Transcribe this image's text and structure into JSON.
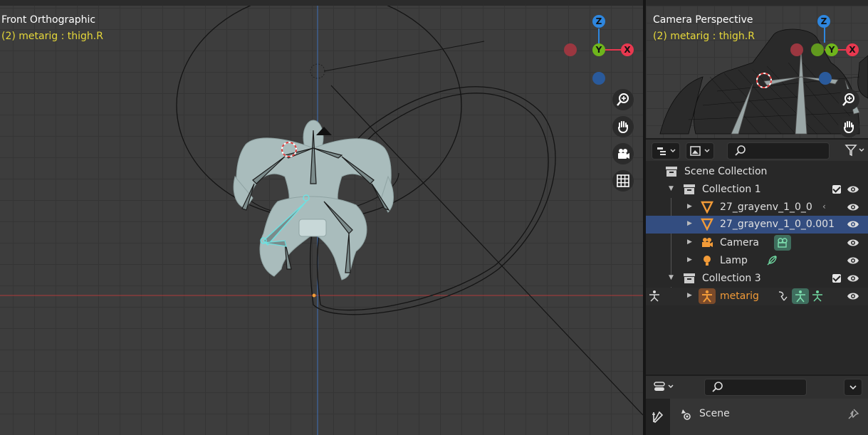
{
  "viewport": {
    "title": "Front Orthographic",
    "subtitle": "(2) metarig : thigh.R",
    "gizmo": {
      "z": "Z",
      "y": "Y",
      "x": "X"
    },
    "nav_icons": [
      "zoom-icon",
      "hand-pan-icon",
      "camera-icon",
      "grid-icon"
    ]
  },
  "camera_view": {
    "title": "Camera Perspective",
    "subtitle": "(2) metarig : thigh.R",
    "gizmo": {
      "z": "Z",
      "y": "Y",
      "x": "X"
    }
  },
  "outliner": {
    "search_placeholder": "",
    "rows": [
      {
        "label": "Scene Collection"
      },
      {
        "label": "Collection 1"
      },
      {
        "label": "27_grayenv_1_0_0"
      },
      {
        "label": "27_grayenv_1_0_0.001"
      },
      {
        "label": "Camera"
      },
      {
        "label": "Lamp"
      },
      {
        "label": "Collection 3"
      },
      {
        "label": "metarig"
      }
    ]
  },
  "properties": {
    "search_placeholder": "",
    "scene_label": "Scene"
  },
  "colors": {
    "accent_selected": "#334d80",
    "axis_x": "#e8384f",
    "axis_y": "#6fb51c",
    "axis_z": "#2e86de",
    "highlight_text": "#e6d83a",
    "active_object": "#f29b38"
  }
}
